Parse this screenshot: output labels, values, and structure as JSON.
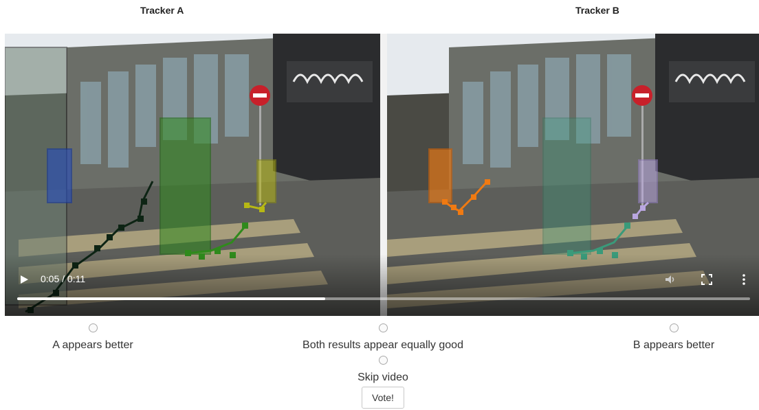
{
  "tracker_a": {
    "title": "Tracker A"
  },
  "tracker_b": {
    "title": "Tracker B"
  },
  "video": {
    "time": "0:05 / 0:11",
    "progress": 0.42,
    "play_icon": "play-icon",
    "volume_icon": "volume-icon",
    "fullscreen_icon": "fullscreen-icon",
    "menu_icon": "more-vertical-icon"
  },
  "options": {
    "a_better": "A appears better",
    "equal": "Both results appear equally good",
    "b_better": "B appears better",
    "skip": "Skip video"
  },
  "vote_label": "Vote!",
  "colors": {
    "track_black": "#0d2414",
    "track_green": "#2f8a1c",
    "track_yellow": "#b7b814",
    "track_blue": "#2a4fb8",
    "track_orange": "#f07a12",
    "track_teal": "#3a9a7a",
    "track_lavender": "#b9a6e0"
  }
}
